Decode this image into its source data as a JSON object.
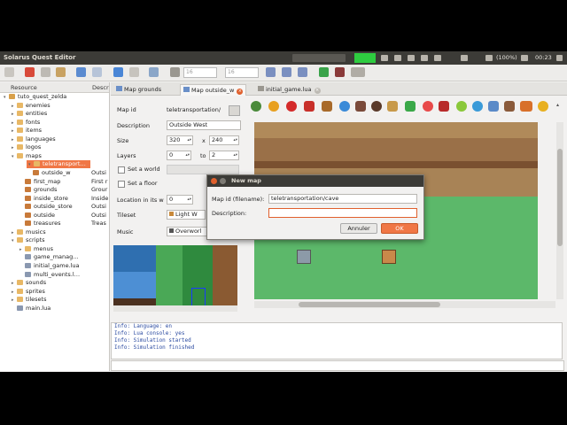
{
  "window": {
    "title": "Solarus Quest Editor",
    "tray": {
      "battery": "(100%)",
      "clock": "00:23"
    }
  },
  "toolbar": {
    "grid_x": "16",
    "grid_y": "16"
  },
  "tree": {
    "col_resource": "Resource",
    "col_description": "Descr",
    "rows": [
      {
        "label": "tuto_quest_zelda",
        "desc": "",
        "level": 0,
        "expander": "▾",
        "icon": "quest"
      },
      {
        "label": "enemies",
        "desc": "",
        "level": 1,
        "expander": "▸",
        "icon": "folder"
      },
      {
        "label": "entities",
        "desc": "",
        "level": 1,
        "expander": "▸",
        "icon": "folder"
      },
      {
        "label": "fonts",
        "desc": "",
        "level": 1,
        "expander": "▸",
        "icon": "folder"
      },
      {
        "label": "items",
        "desc": "",
        "level": 1,
        "expander": "▸",
        "icon": "folder"
      },
      {
        "label": "languages",
        "desc": "",
        "level": 1,
        "expander": "▸",
        "icon": "folder"
      },
      {
        "label": "logos",
        "desc": "",
        "level": 1,
        "expander": "▸",
        "icon": "folder"
      },
      {
        "label": "maps",
        "desc": "",
        "level": 1,
        "expander": "▾",
        "icon": "folder"
      },
      {
        "label": "teletransport…",
        "desc": "",
        "level": 2,
        "expander": "▾",
        "icon": "folder",
        "selected": true
      },
      {
        "label": "outside_w",
        "desc": "Outsi",
        "level": 3,
        "expander": "",
        "icon": "map"
      },
      {
        "label": "first_map",
        "desc": "First r",
        "level": 2,
        "expander": "",
        "icon": "map"
      },
      {
        "label": "grounds",
        "desc": "Grour",
        "level": 2,
        "expander": "",
        "icon": "map"
      },
      {
        "label": "inside_store",
        "desc": "Inside",
        "level": 2,
        "expander": "",
        "icon": "map"
      },
      {
        "label": "outside_store",
        "desc": "Outsi",
        "level": 2,
        "expander": "",
        "icon": "map"
      },
      {
        "label": "outside",
        "desc": "Outsi",
        "level": 2,
        "expander": "",
        "icon": "map"
      },
      {
        "label": "treasures",
        "desc": "Treas",
        "level": 2,
        "expander": "",
        "icon": "map"
      },
      {
        "label": "musics",
        "desc": "",
        "level": 1,
        "expander": "▸",
        "icon": "folder"
      },
      {
        "label": "scripts",
        "desc": "",
        "level": 1,
        "expander": "▾",
        "icon": "folder"
      },
      {
        "label": "menus",
        "desc": "",
        "level": 2,
        "expander": "▸",
        "icon": "folder"
      },
      {
        "label": "game_manag…",
        "desc": "",
        "level": 2,
        "expander": "",
        "icon": "file"
      },
      {
        "label": "initial_game.lua",
        "desc": "",
        "level": 2,
        "expander": "",
        "icon": "file"
      },
      {
        "label": "multi_events.l…",
        "desc": "",
        "level": 2,
        "expander": "",
        "icon": "file"
      },
      {
        "label": "sounds",
        "desc": "",
        "level": 1,
        "expander": "▸",
        "icon": "folder"
      },
      {
        "label": "sprites",
        "desc": "",
        "level": 1,
        "expander": "▸",
        "icon": "folder"
      },
      {
        "label": "tilesets",
        "desc": "",
        "level": 1,
        "expander": "▸",
        "icon": "folder"
      },
      {
        "label": "main.lua",
        "desc": "",
        "level": 1,
        "expander": "",
        "icon": "file"
      }
    ]
  },
  "tabs": [
    {
      "label": "Map grounds"
    },
    {
      "label": "Map outside_w"
    },
    {
      "label": "initial_game.lua"
    }
  ],
  "map_props": {
    "map_id_label": "Map id",
    "map_id_value": "teletransportation/",
    "description_label": "Description",
    "description_value": "Outside West",
    "size_label": "Size",
    "size_w": "320",
    "size_x": "x",
    "size_h": "240",
    "layers_label": "Layers",
    "layers_from": "0",
    "layers_to_word": "to",
    "layers_to": "2",
    "set_world_label": "Set a world",
    "set_floor_label": "Set a floor",
    "location_label": "Location in its w",
    "location_x": "0",
    "tileset_label": "Tileset",
    "tileset_value": "Light W",
    "music_label": "Music",
    "music_value": "Overworl"
  },
  "console": {
    "lines": [
      "Info: Language: en",
      "Info: Lua console: yes",
      "Info: Simulation started",
      "Info: Simulation finished"
    ]
  },
  "dialog": {
    "title": "New map",
    "map_id_label": "Map id (filename):",
    "map_id_value": "teletransportation/cave",
    "description_label": "Description:",
    "description_value": "",
    "cancel_label": "Annuler",
    "ok_label": "OK"
  },
  "colors": {
    "accent": "#f07746",
    "titlebar": "#3c3b37",
    "grass": "#5cb86a",
    "ok_button": "#f07746"
  }
}
